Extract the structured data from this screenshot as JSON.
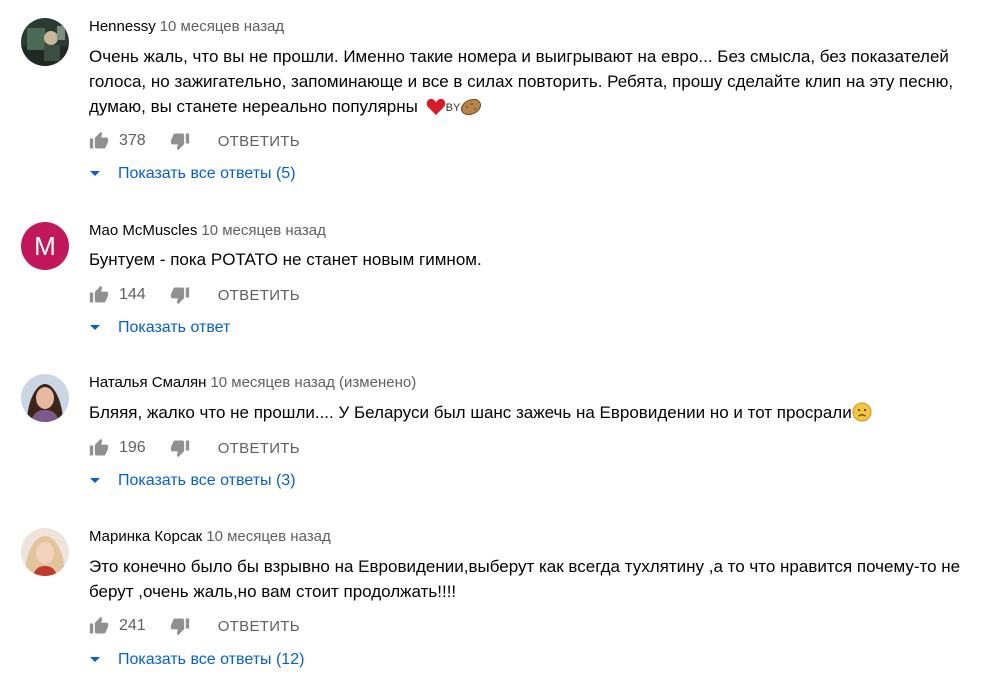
{
  "comments": [
    {
      "author": "Hennessy",
      "time": "10 месяцев назад",
      "text": "Очень жаль, что вы не прошли. Именно такие номера и выигрывают на евро... Без смысла, без показателей голоса, но зажигательно, запоминающе и все в силах повторить. Ребята, прошу сделайте клип на эту песню, думаю, вы станете нереально популярны",
      "emoji_text": "BY",
      "likes": "378",
      "reply_label": "ОТВЕТИТЬ",
      "replies_label": "Показать все ответы (5)"
    },
    {
      "author": "Mao McMuscles",
      "time": "10 месяцев назад",
      "avatar_letter": "M",
      "text": "Бунтуем - пока POTATO не станет новым гимном.",
      "likes": "144",
      "reply_label": "ОТВЕТИТЬ",
      "replies_label": "Показать ответ"
    },
    {
      "author": "Наталья Смалян",
      "time": "10 месяцев назад (изменено)",
      "text": "Бляяя, жалко что не прошли.... У Беларуси был шанс зажечь на Евровидении но и тот просрали",
      "likes": "196",
      "reply_label": "ОТВЕТИТЬ",
      "replies_label": "Показать все ответы (3)"
    },
    {
      "author": "Маринка Корсак",
      "time": "10 месяцев назад",
      "text": "Это конечно было бы взрывно на Евровидении,выберут как всегда тухлятину ,а то что нравится почему-то не берут ,очень жаль,но вам стоит продолжать!!!!",
      "likes": "241",
      "reply_label": "ОТВЕТИТЬ",
      "replies_label": "Показать все ответы (12)"
    }
  ],
  "icons": {
    "like": "thumb-up-icon",
    "dislike": "thumb-down-icon",
    "expand": "caret-down-icon"
  },
  "colors": {
    "link": "#065fd4",
    "secondary_text": "#606060",
    "avatar_mao": "#c2185b",
    "heart": "#d81b2a"
  }
}
